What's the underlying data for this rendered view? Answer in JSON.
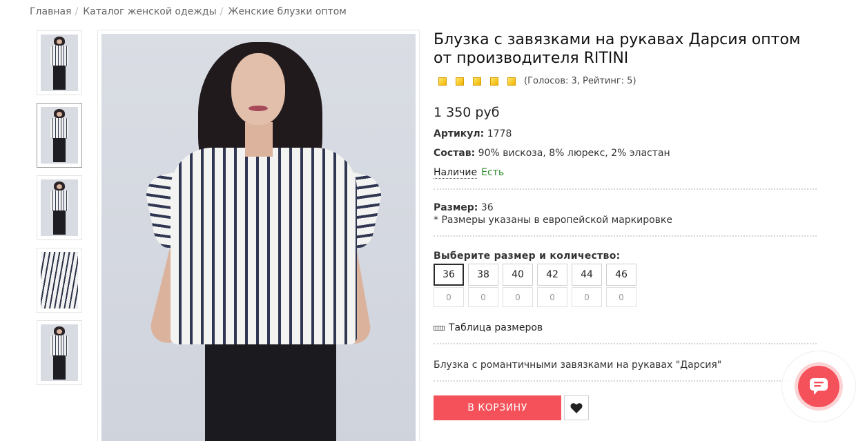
{
  "breadcrumb": {
    "items": [
      "Главная",
      "Каталог женской одежды",
      "Женские блузки оптом"
    ],
    "separator": "/"
  },
  "thumbnails": [
    {
      "type": "full",
      "active": false
    },
    {
      "type": "full",
      "active": true
    },
    {
      "type": "full",
      "active": false
    },
    {
      "type": "closeup",
      "active": false
    },
    {
      "type": "full",
      "active": false
    }
  ],
  "product": {
    "title": "Блузка с завязками на рукавах Дарсия оптом от производителя RITINI",
    "rating_stars": 5,
    "rating_text": "(Голосов: 3, Рейтинг: 5)",
    "price": "1 350 руб",
    "article_label": "Артикул:",
    "article_value": "1778",
    "composition_label": "Состав:",
    "composition_value": "90% вискоза, 8% люрекс, 2% эластан",
    "availability_label": "Наличие",
    "availability_value": "Есть",
    "size_label": "Размер:",
    "size_value": "36",
    "size_note": "* Размеры указаны в европейской маркировке",
    "choose_label": "Выберите размер и количество:",
    "sizes": [
      {
        "size": "36",
        "qty": "0",
        "active": true
      },
      {
        "size": "38",
        "qty": "0",
        "active": false
      },
      {
        "size": "40",
        "qty": "0",
        "active": false
      },
      {
        "size": "42",
        "qty": "0",
        "active": false
      },
      {
        "size": "44",
        "qty": "0",
        "active": false
      },
      {
        "size": "46",
        "qty": "0",
        "active": false
      }
    ],
    "size_table_label": "Таблица размеров",
    "description": "Блузка с романтичными завязками на рукавах \"Дарсия\"",
    "cart_button": "В КОРЗИНУ",
    "favorite_icon": "heart-icon"
  },
  "colors": {
    "accent": "#f4515a",
    "available": "#2e8b2e",
    "star": "#f1b400"
  },
  "chat": {
    "icon": "chat-bubble-icon"
  }
}
